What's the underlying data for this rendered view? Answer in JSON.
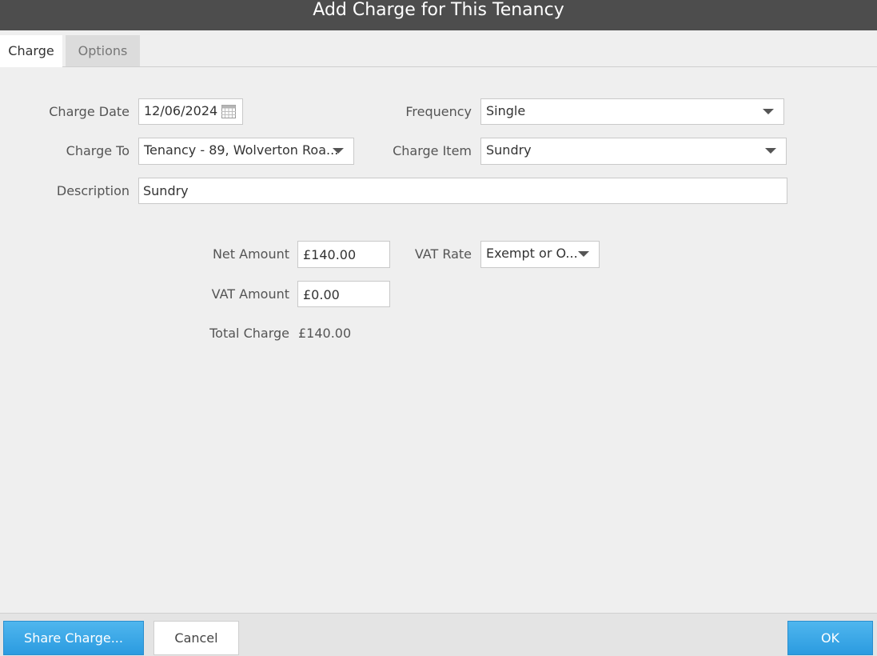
{
  "dialog": {
    "title": "Add Charge for This Tenancy"
  },
  "tabs": [
    {
      "label": "Charge",
      "active": true
    },
    {
      "label": "Options",
      "active": false
    }
  ],
  "form": {
    "charge_date": {
      "label": "Charge Date",
      "value": "12/06/2024"
    },
    "frequency": {
      "label": "Frequency",
      "value": "Single"
    },
    "charge_to": {
      "label": "Charge To",
      "value": "Tenancy - 89, Wolverton Roa..."
    },
    "charge_item": {
      "label": "Charge Item",
      "value": "Sundry"
    },
    "description": {
      "label": "Description",
      "value": "Sundry"
    },
    "net_amount": {
      "label": "Net Amount",
      "value": "£140.00"
    },
    "vat_rate": {
      "label": "VAT Rate",
      "value": "Exempt or O..."
    },
    "vat_amount": {
      "label": "VAT Amount",
      "value": "£0.00"
    },
    "total_charge": {
      "label": "Total Charge",
      "value": "£140.00"
    }
  },
  "footer": {
    "share_label": "Share Charge...",
    "cancel_label": "Cancel",
    "ok_label": "OK"
  },
  "icons": {
    "calendar": "calendar-icon",
    "dropdown": "chevron-down-icon"
  },
  "colors": {
    "titlebar": "#4d4d4d",
    "accent": "#2b9be0",
    "background": "#efefef"
  }
}
